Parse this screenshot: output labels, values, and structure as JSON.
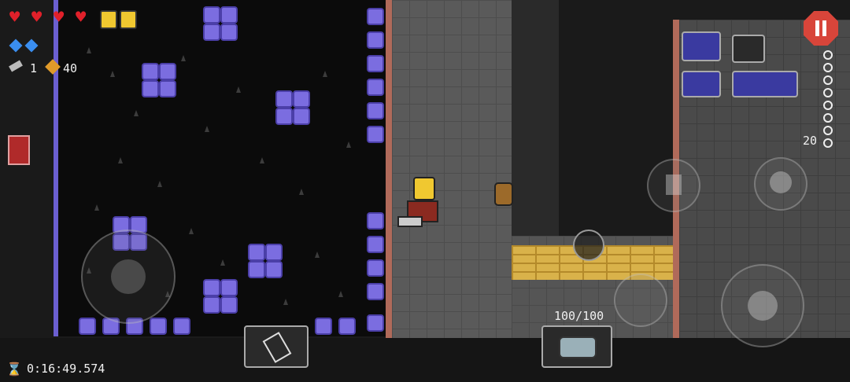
{
  "hud": {
    "hearts": 4,
    "armor": 2,
    "energy_potions": 2,
    "keys": "1",
    "coins": "40",
    "timer": "0:16:49.574",
    "chain_count": "20",
    "ammo": "100/100"
  },
  "icons": {
    "hearts": "heart-icon",
    "armor": "shield-icon",
    "potion": "potion-icon",
    "key": "key-icon",
    "coin": "coin-icon",
    "book": "book-icon",
    "timer": "hourglass-icon",
    "pause": "pause-icon",
    "weapon": "weapon-icon",
    "skill": "skill-icon",
    "item": "item-tag-icon"
  },
  "colors": {
    "heart": "#e0202a",
    "armor": "#f0c830",
    "pause": "#d8453a",
    "block": "#7b6de0"
  }
}
